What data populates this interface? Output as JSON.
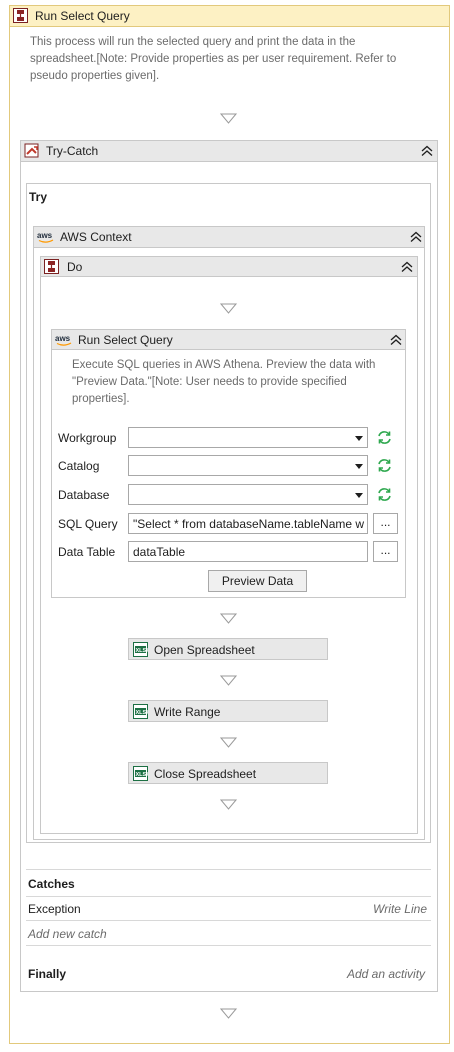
{
  "root": {
    "title": "Run Select Query",
    "description": "This process will run the selected query and print the data in the spreadsheet.[Note: Provide properties as per user requirement. Refer to pseudo properties given]."
  },
  "try_catch": {
    "title": "Try-Catch",
    "try_label": "Try",
    "aws_context": {
      "title": "AWS Context",
      "do": {
        "title": "Do",
        "run_select_query": {
          "title": "Run Select Query",
          "description": "Execute SQL queries in AWS Athena. Preview the data with \"Preview Data.\"[Note: User needs to provide specified properties].",
          "fields": {
            "workgroup_label": "Workgroup",
            "workgroup_value": "",
            "catalog_label": "Catalog",
            "catalog_value": "",
            "database_label": "Database",
            "database_value": "",
            "sql_query_label": "SQL Query",
            "sql_query_value": "\"Select * from databaseName.tableName w",
            "data_table_label": "Data Table",
            "data_table_value": "dataTable",
            "browse_label": "..."
          },
          "preview_button": "Preview Data"
        },
        "activities": [
          "Open Spreadsheet",
          "Write Range",
          "Close Spreadsheet"
        ]
      }
    },
    "catches_label": "Catches",
    "catch": {
      "exception": "Exception",
      "handler": "Write Line"
    },
    "add_new_catch": "Add new catch",
    "finally_label": "Finally",
    "add_activity": "Add an activity"
  },
  "colors": {
    "root_header_bg": "#fdf1c4",
    "root_border": "#e2c97c",
    "header_bg": "#e8e8e8",
    "refresh_green": "#2fa84f",
    "excel_green": "#1d7044"
  },
  "icons": {
    "sequence": "sequence-icon",
    "try_catch": "try-catch-icon",
    "aws": "aws-icon",
    "collapse": "double-chevron-up-icon",
    "refresh": "refresh-icon",
    "excel": "excel-icon",
    "drop": "drop-arrow-icon"
  }
}
